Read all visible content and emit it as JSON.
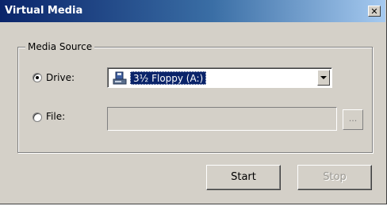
{
  "window": {
    "title": "Virtual Media",
    "close_glyph": "✕"
  },
  "media_source": {
    "legend": "Media Source",
    "drive": {
      "label": "Drive:",
      "selected": true,
      "value": "3½ Floppy (A:)",
      "icon": "floppy-drive-icon"
    },
    "file": {
      "label": "File:",
      "selected": false,
      "value": "",
      "browse_label": "..."
    }
  },
  "actions": {
    "start_label": "Start",
    "stop_label": "Stop",
    "stop_enabled": false
  },
  "colors": {
    "title_bar_start": "#0a246a",
    "title_bar_end": "#a6caf0",
    "face": "#d4d0c8",
    "selection": "#0a246a"
  }
}
